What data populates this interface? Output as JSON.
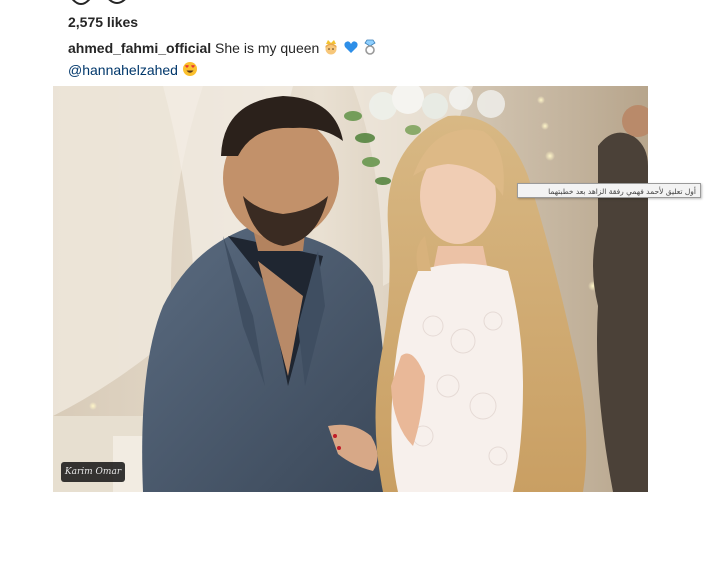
{
  "post": {
    "likes": "2,575 likes",
    "caption": {
      "username": "ahmed_fahmi_official",
      "text": "She is my queen",
      "mention": "@hannahelzahed"
    },
    "icons": [
      "heart-icon",
      "comment-icon",
      "bookmark-icon",
      "princess-emoji",
      "blue-heart-emoji",
      "ring-emoji",
      "heart-eyes-emoji"
    ]
  },
  "photo": {
    "watermark": "Karim Omar",
    "tooltip": "أول تعليق لأحمد فهمي رفقة الزاهد بعد خطبتهما"
  },
  "colors": {
    "text": "#262626",
    "mention": "#00376b",
    "suit": "#4a5a6e",
    "hair": "#d9b98a"
  }
}
